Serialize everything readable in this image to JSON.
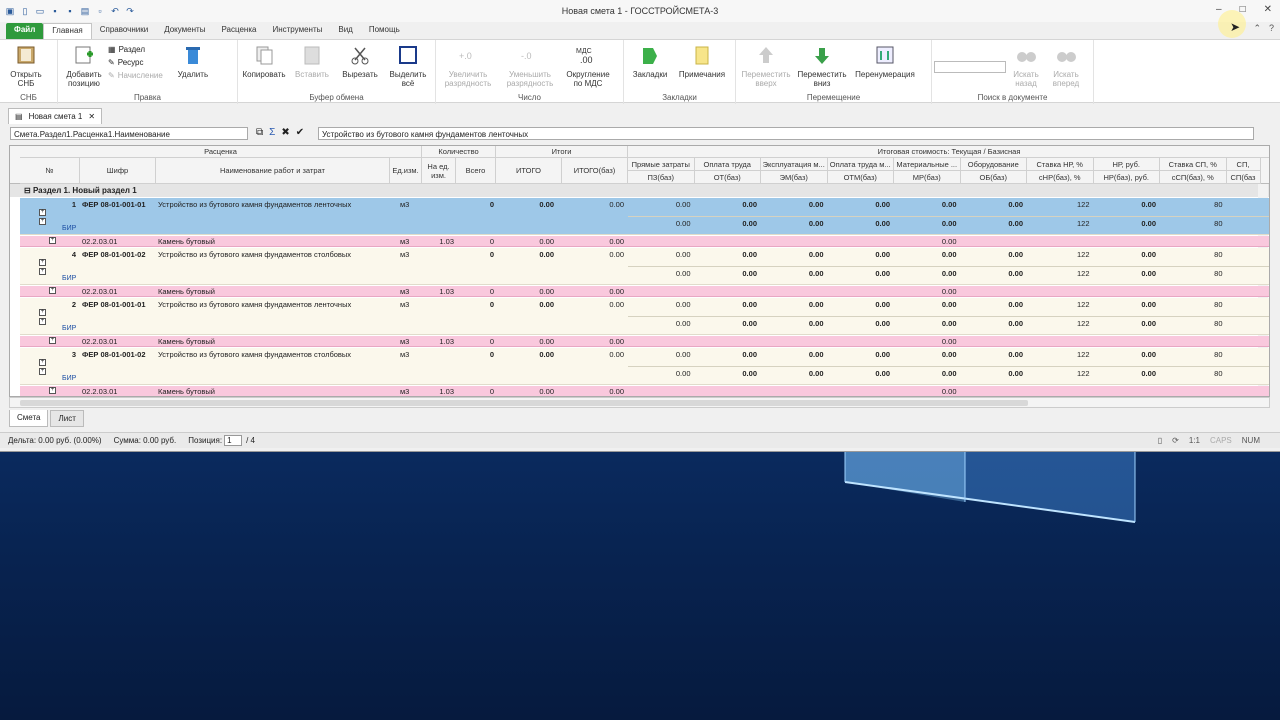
{
  "window": {
    "title": "Новая смета 1 - ГОССТРОЙСМЕТА-3"
  },
  "ribbon_tabs": [
    "Файл",
    "Главная",
    "Справочники",
    "Документы",
    "Расценка",
    "Инструменты",
    "Вид",
    "Помощь"
  ],
  "ribbon": {
    "snb": {
      "open_label": "Открыть СНБ",
      "group": "СНБ"
    },
    "edit": {
      "add_label": "Добавить позицию",
      "section": "Раздел",
      "resource": "Ресурс",
      "charge": "Начисление",
      "delete": "Удалить",
      "group": "Правка"
    },
    "clipboard": {
      "copy": "Копировать",
      "paste": "Вставить",
      "cut": "Вырезать",
      "select_all": "Выделить всё",
      "group": "Буфер обмена"
    },
    "number": {
      "increase": "Увеличить разрядность",
      "decrease": "Уменьшить разрядность",
      "round": "Округление по МДС",
      "round_icon_text": "МДС",
      "group": "Число"
    },
    "bookmarks": {
      "bookmarks": "Закладки",
      "notes": "Примечания",
      "group": "Закладки"
    },
    "move": {
      "up": "Переместить вверх",
      "down": "Переместить вниз",
      "renumber": "Перенумерация",
      "group": "Перемещение"
    },
    "search": {
      "back": "Искать назад",
      "forward": "Искать вперед",
      "group": "Поиск в документе"
    }
  },
  "doc_tab": "Новая смета 1",
  "path_field": "Смета.Раздел1.Расценка1.Наименование",
  "edit_field": "Устройство из бутового камня фундаментов ленточных",
  "grid": {
    "group_headers": {
      "rascenka": "Расценка",
      "qty": "Количество",
      "totals": "Итоги",
      "cost": "Итоговая стоимость: Текущая / Базисная"
    },
    "columns": [
      "№",
      "Шифр",
      "Наименование работ и затрат",
      "Ед.изм.",
      "На ед. изм.",
      "Всего",
      "ИТОГО",
      "ИТОГО(баз)"
    ],
    "cost_top": [
      "Прямые затраты",
      "Оплата труда",
      "Эксплуатация м...",
      "Оплата труда м...",
      "Материальные ...",
      "Оборудование",
      "Ставка НР, %",
      "НР, руб.",
      "Ставка СП, %",
      "СП,"
    ],
    "cost_bottom": [
      "ПЗ(баз)",
      "ОТ(баз)",
      "ЭМ(баз)",
      "ОТМ(баз)",
      "МР(баз)",
      "ОБ(баз)",
      "сНР(баз), %",
      "НР(баз), руб.",
      "сСП(баз), %",
      "СП(баз"
    ],
    "section": "Раздел 1. Новый раздел 1",
    "rows": [
      {
        "num": "1",
        "code": "ФЕР 08-01-001-01",
        "name": "Устройство из бутового камня фундаментов ленточных",
        "unit": "м3",
        "total": "0",
        "itogo": "0.00",
        "itogo_baz": "0.00",
        "bir": "БИР",
        "cost1": [
          "0.00",
          "0.00",
          "0.00",
          "0.00",
          "0.00",
          "0.00",
          "122",
          "0.00",
          "80"
        ],
        "cost2": [
          "0.00",
          "0.00",
          "0.00",
          "0.00",
          "0.00",
          "0.00",
          "122",
          "0.00",
          "80"
        ],
        "res": {
          "code": "02.2.03.01",
          "name": "Камень бутовый",
          "unit": "м3",
          "per": "1.03",
          "total": "0",
          "itogo": "0.00",
          "itogo_baz": "0.00",
          "mr": "0.00"
        }
      },
      {
        "num": "4",
        "code": "ФЕР 08-01-001-02",
        "name": "Устройство из бутового камня фундаментов столбовых",
        "unit": "м3",
        "total": "0",
        "itogo": "0.00",
        "itogo_baz": "0.00",
        "bir": "БИР",
        "cost1": [
          "0.00",
          "0.00",
          "0.00",
          "0.00",
          "0.00",
          "0.00",
          "122",
          "0.00",
          "80"
        ],
        "cost2": [
          "0.00",
          "0.00",
          "0.00",
          "0.00",
          "0.00",
          "0.00",
          "122",
          "0.00",
          "80"
        ],
        "res": {
          "code": "02.2.03.01",
          "name": "Камень бутовый",
          "unit": "м3",
          "per": "1.03",
          "total": "0",
          "itogo": "0.00",
          "itogo_baz": "0.00",
          "mr": "0.00"
        }
      },
      {
        "num": "2",
        "code": "ФЕР 08-01-001-01",
        "name": "Устройство из бутового камня фундаментов ленточных",
        "unit": "м3",
        "total": "0",
        "itogo": "0.00",
        "itogo_baz": "0.00",
        "bir": "БИР",
        "cost1": [
          "0.00",
          "0.00",
          "0.00",
          "0.00",
          "0.00",
          "0.00",
          "122",
          "0.00",
          "80"
        ],
        "cost2": [
          "0.00",
          "0.00",
          "0.00",
          "0.00",
          "0.00",
          "0.00",
          "122",
          "0.00",
          "80"
        ],
        "res": {
          "code": "02.2.03.01",
          "name": "Камень бутовый",
          "unit": "м3",
          "per": "1.03",
          "total": "0",
          "itogo": "0.00",
          "itogo_baz": "0.00",
          "mr": "0.00"
        }
      },
      {
        "num": "3",
        "code": "ФЕР 08-01-001-02",
        "name": "Устройство из бутового камня фундаментов столбовых",
        "unit": "м3",
        "total": "0",
        "itogo": "0.00",
        "itogo_baz": "0.00",
        "bir": "БИР",
        "cost1": [
          "0.00",
          "0.00",
          "0.00",
          "0.00",
          "0.00",
          "0.00",
          "122",
          "0.00",
          "80"
        ],
        "cost2": [
          "0.00",
          "0.00",
          "0.00",
          "0.00",
          "0.00",
          "0.00",
          "122",
          "0.00",
          "80"
        ],
        "res": {
          "code": "02.2.03.01",
          "name": "Камень бутовый",
          "unit": "м3",
          "per": "1.03",
          "total": "0",
          "itogo": "0.00",
          "itogo_baz": "0.00",
          "mr": "0.00"
        }
      }
    ]
  },
  "bottom_tabs": [
    "Смета",
    "Лист"
  ],
  "status": {
    "delta": "Дельта: 0.00 руб. (0.00%)",
    "sum": "Сумма: 0.00 руб.",
    "pos_label": "Позиция:",
    "pos_value": "1",
    "pos_total": "/ 4",
    "scale": "1:1",
    "caps": "CAPS",
    "num": "NUM"
  }
}
